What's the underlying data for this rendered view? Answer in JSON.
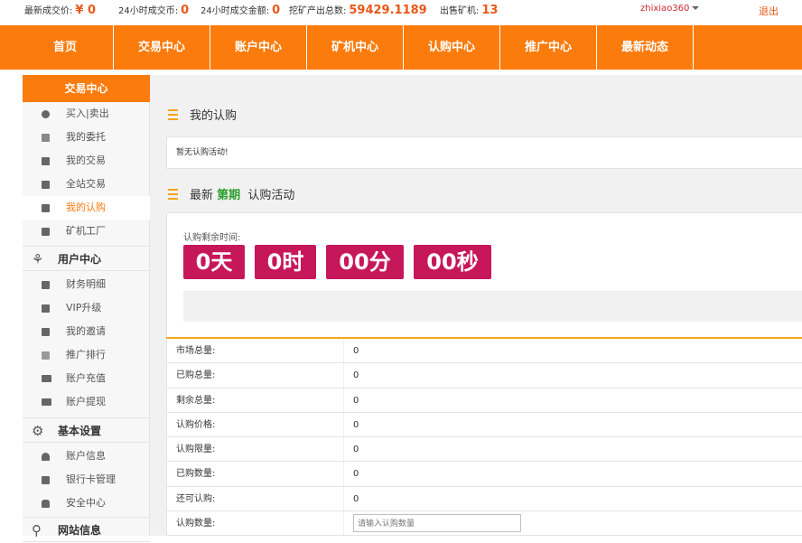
{
  "stats": [
    {
      "label": "最新成交价:",
      "value": "¥ 0"
    },
    {
      "label": "24小时成交币:",
      "value": "0"
    },
    {
      "label": "24小时成交金额:",
      "value": "0"
    },
    {
      "label": "挖矿产出总数:",
      "value": "59429.1189"
    },
    {
      "label": "出售矿机:",
      "value": "13"
    }
  ],
  "user": {
    "name": "zhixiao360",
    "logout": "退出"
  },
  "nav": [
    "首页",
    "交易中心",
    "账户中心",
    "矿机中心",
    "认购中心",
    "推广中心",
    "最新动态"
  ],
  "sidebar": {
    "head": "交易中心",
    "trade_items": [
      {
        "label": "买入|卖出",
        "icon": "coin-icon"
      },
      {
        "label": "我的委托",
        "icon": "entrust-icon"
      },
      {
        "label": "我的交易",
        "icon": "document-icon"
      },
      {
        "label": "全站交易",
        "icon": "edit-icon"
      },
      {
        "label": "我的认购",
        "icon": "edit-icon",
        "active": true
      },
      {
        "label": "矿机工厂",
        "icon": "document-icon"
      }
    ],
    "user_section": "用户中心",
    "user_items": [
      {
        "label": "财务明细",
        "icon": "edit-icon"
      },
      {
        "label": "VIP升级",
        "icon": "edit-icon"
      },
      {
        "label": "我的邀请",
        "icon": "document-icon"
      },
      {
        "label": "推广排行",
        "icon": "bar-chart-icon"
      },
      {
        "label": "账户充值",
        "icon": "card-icon"
      },
      {
        "label": "账户提现",
        "icon": "card-icon"
      }
    ],
    "settings_section": "基本设置",
    "settings_items": [
      {
        "label": "账户信息",
        "icon": "user-icon"
      },
      {
        "label": "银行卡管理",
        "icon": "edit-icon"
      },
      {
        "label": "安全中心",
        "icon": "lock-icon"
      }
    ],
    "site_section": "网站信息"
  },
  "main": {
    "my_subscription_title": "我的认购",
    "no_activity_notice": "暂无认购活动!",
    "latest_title_prefix": "最新",
    "latest_title_period": "第期",
    "latest_title_suffix": "认购活动",
    "countdown_label": "认购剩余时间:",
    "countdown": {
      "days": "0天",
      "hours": "0时",
      "minutes": "00分",
      "seconds": "00秒"
    },
    "fields": [
      {
        "label": "市场总量:",
        "value": "0"
      },
      {
        "label": "已购总量:",
        "value": "0"
      },
      {
        "label": "剩余总量:",
        "value": "0"
      },
      {
        "label": "认购价格:",
        "value": "0"
      },
      {
        "label": "认购限量:",
        "value": "0"
      },
      {
        "label": "已购数量:",
        "value": "0"
      },
      {
        "label": "还可认购:",
        "value": "0"
      }
    ],
    "quantity_label": "认购数量:",
    "quantity_placeholder": "请输入认购数量"
  }
}
